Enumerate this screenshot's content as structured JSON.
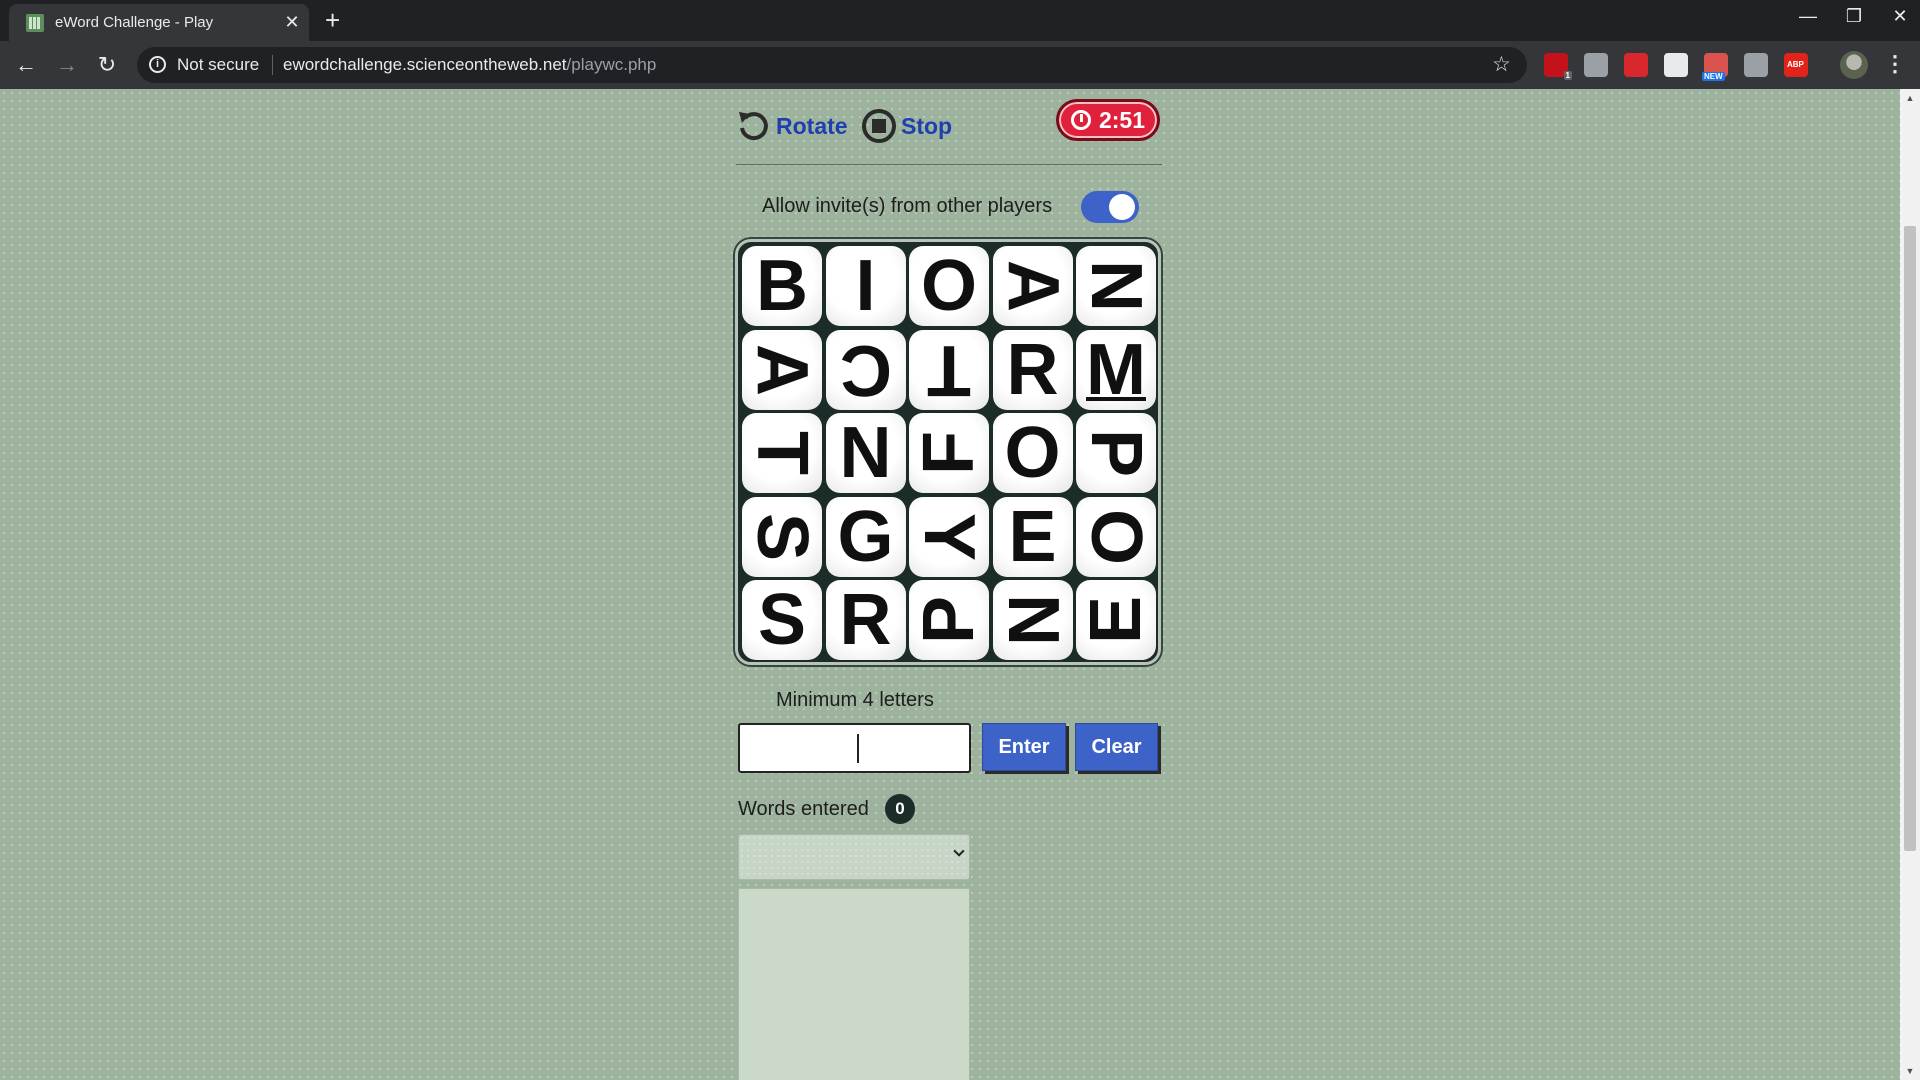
{
  "browser": {
    "tab_title": "eWord Challenge - Play",
    "tab_close": "✕",
    "new_tab": "+",
    "not_secure": "Not secure",
    "url_host": "ewordchallenge.scienceontheweb.net",
    "url_path": "/playwc.php",
    "extensions": [
      {
        "name": "ublock-icon",
        "color": "#c4121b",
        "badge": "1"
      },
      {
        "name": "extension-icon",
        "color": "#9aa0a6",
        "badge": ""
      },
      {
        "name": "mega-icon",
        "color": "#d9272e",
        "badge": ""
      },
      {
        "name": "plus-extension-icon",
        "color": "#e8eaed",
        "badge": ""
      },
      {
        "name": "new-extension-icon",
        "color": "#d9534f",
        "badge": "NEW"
      },
      {
        "name": "clipboard-icon",
        "color": "#9aa0a6",
        "badge": ""
      },
      {
        "name": "adblock-plus-icon",
        "color": "#e2231a",
        "badge": "ABP"
      }
    ]
  },
  "game": {
    "rotate_label": "Rotate",
    "stop_label": "Stop",
    "timer": "2:51",
    "invite_label": "Allow invite(s) from other players",
    "invite_enabled": true,
    "board": [
      [
        {
          "l": "B",
          "r": 0
        },
        {
          "l": "I",
          "r": 0
        },
        {
          "l": "O",
          "r": 0
        },
        {
          "l": "A",
          "r": 90
        },
        {
          "l": "N",
          "r": 90
        }
      ],
      [
        {
          "l": "A",
          "r": 90
        },
        {
          "l": "C",
          "r": 180
        },
        {
          "l": "T",
          "r": 180
        },
        {
          "l": "R",
          "r": 0
        },
        {
          "l": "M",
          "r": 0,
          "u": true
        }
      ],
      [
        {
          "l": "T",
          "r": 90
        },
        {
          "l": "N",
          "r": 0
        },
        {
          "l": "F",
          "r": 270
        },
        {
          "l": "O",
          "r": 0
        },
        {
          "l": "P",
          "r": 90
        }
      ],
      [
        {
          "l": "S",
          "r": 90
        },
        {
          "l": "G",
          "r": 0
        },
        {
          "l": "Y",
          "r": 90
        },
        {
          "l": "E",
          "r": 0
        },
        {
          "l": "O",
          "r": 90
        }
      ],
      [
        {
          "l": "S",
          "r": 0
        },
        {
          "l": "R",
          "r": 0
        },
        {
          "l": "P",
          "r": 270
        },
        {
          "l": "N",
          "r": 90
        },
        {
          "l": "E",
          "r": 270
        }
      ]
    ],
    "min_label": "Minimum 4 letters",
    "input_value": "",
    "enter_label": "Enter",
    "clear_label": "Clear",
    "words_label": "Words entered",
    "words_count": "0",
    "words_selected": ""
  }
}
